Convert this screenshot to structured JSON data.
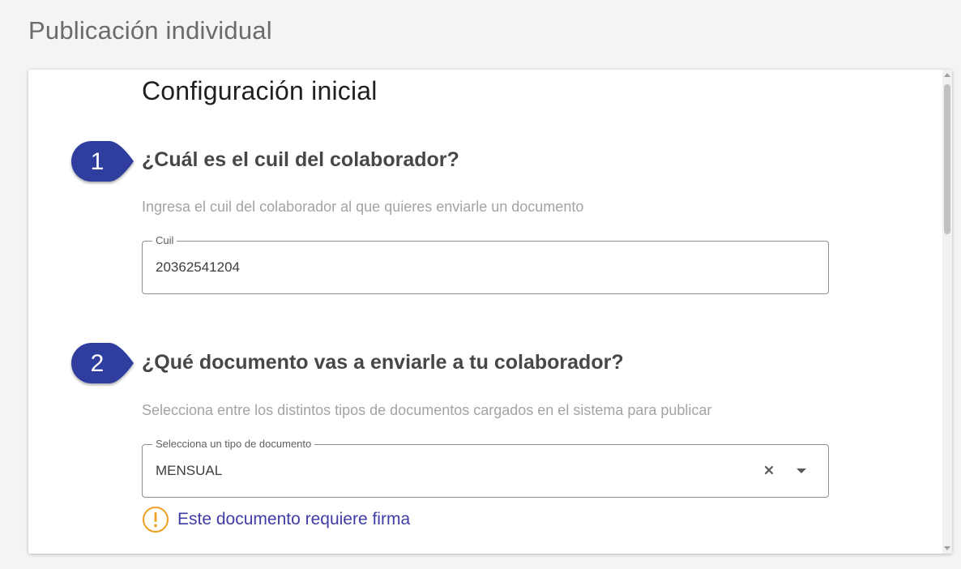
{
  "page": {
    "title": "Publicación individual"
  },
  "card": {
    "section_title": "Configuración inicial",
    "steps": [
      {
        "number": "1",
        "question": "¿Cuál es el cuil del colaborador?",
        "hint": "Ingresa el cuil del colaborador al que quieres enviarle un documento",
        "field_label": "Cuil",
        "field_value": "20362541204"
      },
      {
        "number": "2",
        "question": "¿Qué documento vas a enviarle a tu colaborador?",
        "hint": "Selecciona entre los distintos tipos de documentos cargados en el sistema para publicar",
        "field_label": "Selecciona un tipo de documento",
        "field_value": "MENSUAL"
      }
    ],
    "notice": {
      "icon": "warning-icon",
      "text": "Este documento requiere firma"
    }
  },
  "colors": {
    "badge": "#2f3e9e",
    "notice_text": "#3f3ca6",
    "warning": "#f0a020"
  }
}
